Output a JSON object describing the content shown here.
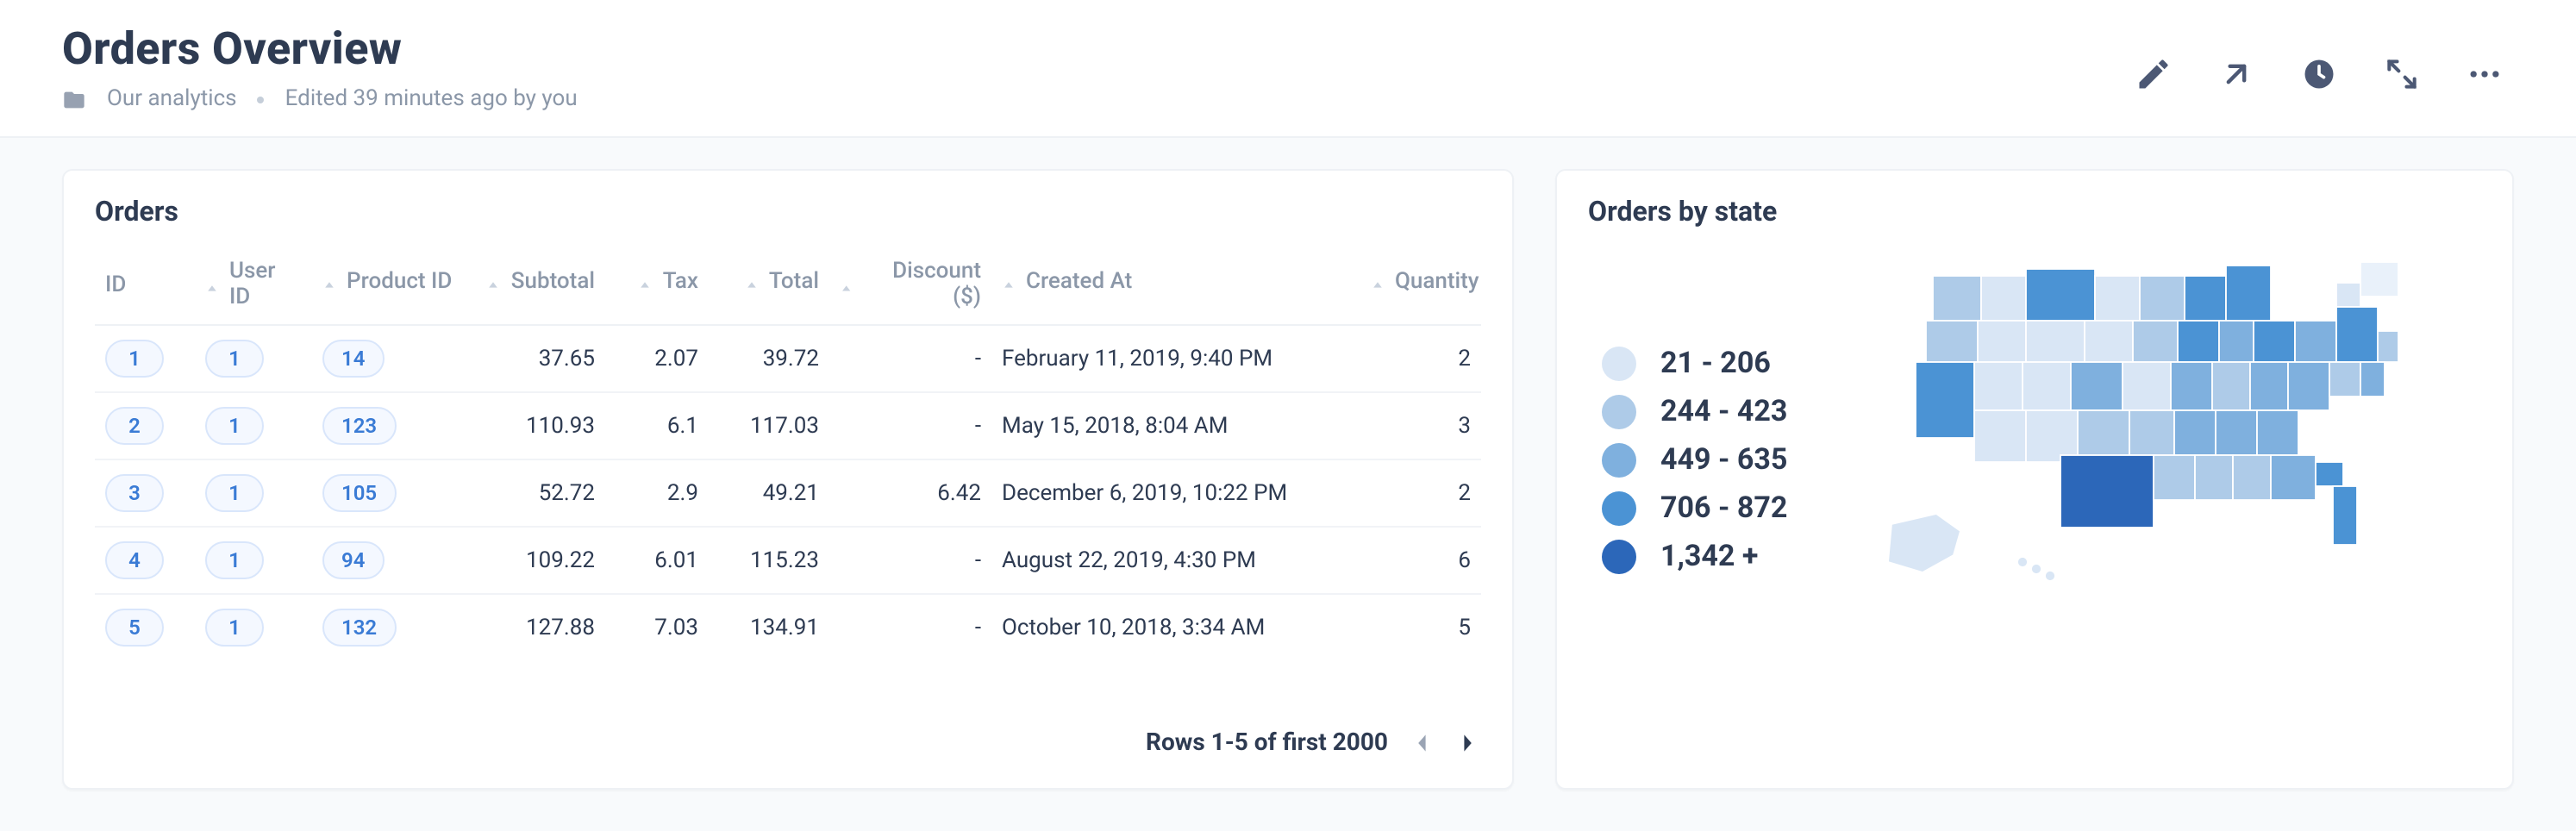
{
  "header": {
    "title": "Orders Overview",
    "collection": "Our analytics",
    "edited": "Edited 39 minutes ago by you"
  },
  "cards": {
    "orders": {
      "title": "Orders",
      "columns": {
        "id": "ID",
        "user": "User ID",
        "product": "Product ID",
        "subtotal": "Subtotal",
        "tax": "Tax",
        "total": "Total",
        "discount": "Discount ($)",
        "created": "Created At",
        "qty": "Quantity"
      },
      "rows": [
        {
          "id": "1",
          "user": "1",
          "product": "14",
          "subtotal": "37.65",
          "tax": "2.07",
          "total": "39.72",
          "discount": "-",
          "created": "February 11, 2019, 9:40 PM",
          "qty": "2"
        },
        {
          "id": "2",
          "user": "1",
          "product": "123",
          "subtotal": "110.93",
          "tax": "6.1",
          "total": "117.03",
          "discount": "-",
          "created": "May 15, 2018, 8:04 AM",
          "qty": "3"
        },
        {
          "id": "3",
          "user": "1",
          "product": "105",
          "subtotal": "52.72",
          "tax": "2.9",
          "total": "49.21",
          "discount": "6.42",
          "created": "December 6, 2019, 10:22 PM",
          "qty": "2"
        },
        {
          "id": "4",
          "user": "1",
          "product": "94",
          "subtotal": "109.22",
          "tax": "6.01",
          "total": "115.23",
          "discount": "-",
          "created": "August 22, 2019, 4:30 PM",
          "qty": "6"
        },
        {
          "id": "5",
          "user": "1",
          "product": "132",
          "subtotal": "127.88",
          "tax": "7.03",
          "total": "134.91",
          "discount": "-",
          "created": "October 10, 2018, 3:34 AM",
          "qty": "5"
        }
      ],
      "pager": "Rows 1-5 of first 2000"
    },
    "map": {
      "title": "Orders by state",
      "legend": {
        "b1": {
          "label": "21 - 206",
          "color": "#d9e6f5"
        },
        "b2": {
          "label": "244 - 423",
          "color": "#aecbe8"
        },
        "b3": {
          "label": "449 - 635",
          "color": "#7fb0de"
        },
        "b4": {
          "label": "706 - 872",
          "color": "#4b93d4"
        },
        "b5": {
          "label": "1,342 +",
          "color": "#2c67b9"
        }
      }
    }
  }
}
